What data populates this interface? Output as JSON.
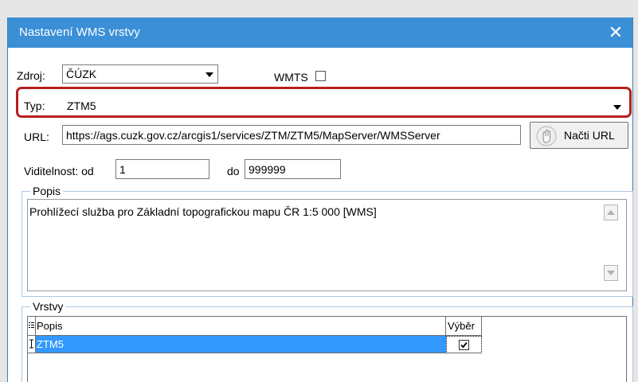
{
  "window": {
    "title": "Nastavení WMS vrstvy",
    "close_glyph": "✕"
  },
  "form": {
    "source_label": "Zdroj:",
    "source_value": "ČÚZK",
    "wmts_label": "WMTS",
    "wmts_checked": false,
    "type_label": "Typ:",
    "type_value": "ZTM5",
    "url_label": "URL:",
    "url_value": "https://ags.cuzk.gov.cz/arcgis1/services/ZTM/ZTM5/MapServer/WMSServer",
    "load_url_button": "Načti URL",
    "visibility_from_label": "Viditelnost: od",
    "visibility_from_value": "1",
    "visibility_to_label": "do",
    "visibility_to_value": "999999"
  },
  "description_group": {
    "label": "Popis",
    "text": "Prohlížecí služba pro Základní topografickou mapu ČR 1:5 000 [WMS]"
  },
  "layers_group": {
    "label": "Vrstvy",
    "columns": [
      "Popis",
      "Výběr"
    ],
    "rows": [
      {
        "name": "ZTM5",
        "selected": true
      }
    ]
  },
  "colors": {
    "title_bar": "#3b8fd6",
    "highlight": "#b51f1f",
    "selected_row": "#3399ff"
  },
  "icons": {
    "close": "close-icon",
    "dropdown": "chevron-down-icon",
    "load_url": "hand-pointer-icon",
    "scroll_up": "scroll-up-arrow-icon",
    "scroll_down": "scroll-down-arrow-icon",
    "column_menu": "column-list-icon",
    "row_edit": "text-cursor-icon",
    "checkbox": "checkmark-icon"
  }
}
